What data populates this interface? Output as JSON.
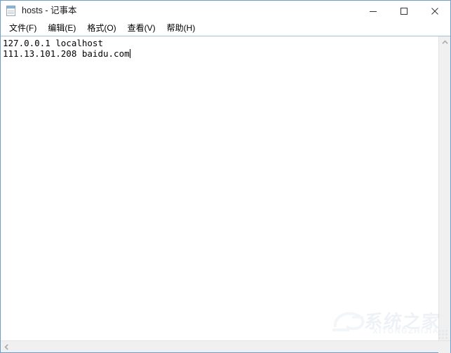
{
  "window": {
    "title": "hosts - 记事本",
    "app_icon": "notepad-icon",
    "accent_border": "#6f9dc9",
    "controls": {
      "minimize": "最小化",
      "maximize": "最大化",
      "close": "关闭"
    }
  },
  "menu": {
    "items": [
      {
        "label": "文件(F)"
      },
      {
        "label": "编辑(E)"
      },
      {
        "label": "格式(O)"
      },
      {
        "label": "查看(V)"
      },
      {
        "label": "帮助(H)"
      }
    ]
  },
  "editor": {
    "line1": "127.0.0.1 localhost",
    "line2": "111.13.101.208 baidu.com",
    "content": "127.0.0.1 localhost\n111.13.101.208 baidu.com"
  },
  "scrollbars": {
    "vertical_up_arrow": "chevron-up-icon",
    "horizontal_left_arrow": "chevron-left-icon"
  },
  "watermark": {
    "cn": "系统之家",
    "en": "XITONGZHIJIA"
  }
}
